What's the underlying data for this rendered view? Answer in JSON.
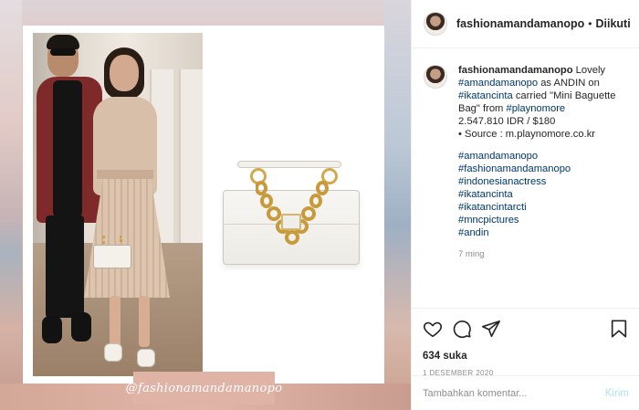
{
  "post": {
    "watermark": "@fashionamandamanopo"
  },
  "header": {
    "username": "fashionamandamanopo",
    "separator": "•",
    "follow_label": "Diikuti"
  },
  "caption": {
    "username": "fashionamandamanopo",
    "line1_text": " Lovely ",
    "tag_amanda": "#amandamanopo",
    "line2_text": " as ANDIN on ",
    "tag_ikatan": "#ikatancinta",
    "line3_text": " carried \"Mini Baguette Bag\" from ",
    "tag_playnomore": "#playnomore",
    "price": "2.547.810 IDR / $180",
    "source": "• Source : m.playnomore.co.kr",
    "hashtags": [
      "#amandamanopo",
      "#fashionamandamanopo",
      "#indonesianactress",
      "#ikatancinta",
      "#ikatancintarcti",
      "#mncpictures",
      "#andin"
    ],
    "time_ago": "7 ming"
  },
  "actions": {
    "icons": [
      "heart-icon",
      "comment-icon",
      "share-icon",
      "bookmark-icon"
    ],
    "likes": "634 suka",
    "date": "1 DESEMBER 2020"
  },
  "comment_box": {
    "placeholder": "Tambahkan komentar...",
    "post_label": "Kirim"
  },
  "colors": {
    "link": "#00376b",
    "muted": "#8e8e8e",
    "post_button_disabled": "#b2dffc",
    "watermark_bg": "#e0b3a7"
  }
}
